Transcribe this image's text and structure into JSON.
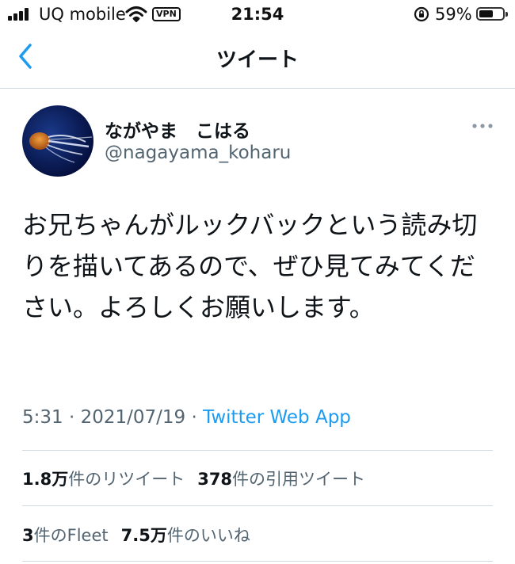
{
  "status_bar": {
    "carrier": "UQ mobile",
    "vpn": "VPN",
    "time": "21:54",
    "battery_percent": "59%",
    "battery_level": 0.59
  },
  "nav": {
    "title": "ツイート"
  },
  "tweet": {
    "display_name": "ながやま　こはる",
    "handle": "@nagayama_koharu",
    "text": "お兄ちゃんがルックバックという読み切りを描いてあるので、ぜひ見てみてください。よろしくお願いします。",
    "time": "5:31",
    "date": "2021/07/19",
    "dot": "·",
    "source": "Twitter Web App"
  },
  "stats": {
    "retweets_count": "1.8万",
    "retweets_label": "件のリツイート",
    "quotes_count": "378",
    "quotes_label": "件の引用ツイート",
    "fleets_count": "3",
    "fleets_label": "件のFleet",
    "likes_count": "7.5万",
    "likes_label": "件のいいね"
  },
  "colors": {
    "accent": "#1d9bf0",
    "secondary_text": "#536471",
    "divider": "#cfd9de"
  },
  "icons": [
    "cellular-signal-icon",
    "wifi-icon",
    "orientation-lock-icon",
    "battery-icon",
    "back-chevron-icon",
    "more-icon"
  ]
}
